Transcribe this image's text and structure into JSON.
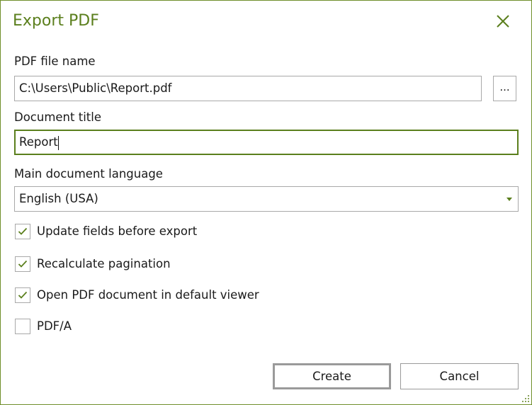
{
  "dialog": {
    "title": "Export PDF"
  },
  "pdf_file_name": {
    "label": "PDF file name",
    "value": "C:\\Users\\Public\\Report.pdf",
    "browse_label": "..."
  },
  "document_title": {
    "label": "Document title",
    "value": "Report"
  },
  "language": {
    "label": "Main document language",
    "selected": "English (USA)"
  },
  "options": [
    {
      "label": "Update fields before export",
      "checked": true
    },
    {
      "label": "Recalculate pagination",
      "checked": true
    },
    {
      "label": "Open PDF document in default viewer",
      "checked": true
    },
    {
      "label": "PDF/A",
      "checked": false
    }
  ],
  "buttons": {
    "create": "Create",
    "cancel": "Cancel"
  },
  "colors": {
    "accent": "#5b7f1d",
    "border": "#a9a9a9"
  },
  "icons": {
    "close": "close-icon",
    "check": "check-icon",
    "dropdown": "chevron-down-icon",
    "resize": "resize-grip-icon"
  }
}
